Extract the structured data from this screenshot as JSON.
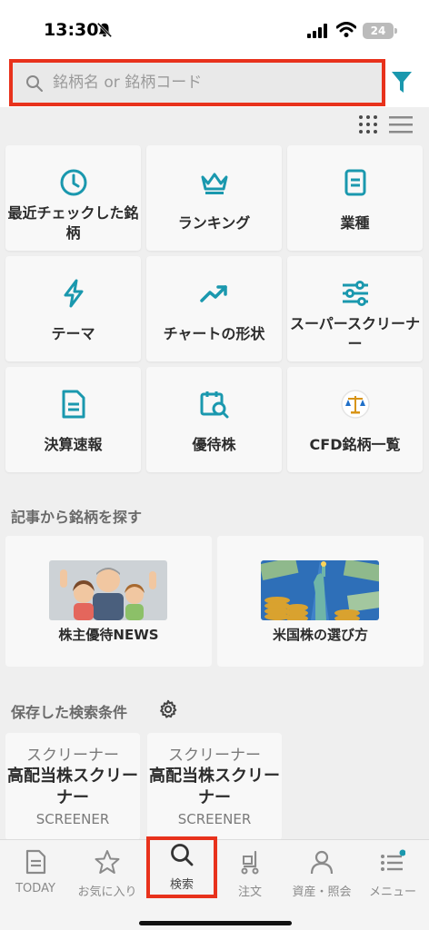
{
  "status_bar": {
    "time": "13:30",
    "battery": "24"
  },
  "search": {
    "placeholder": "銘柄名 or 銘柄コード"
  },
  "icons": {
    "search": "search-icon",
    "filter": "filter-icon",
    "grid": "grid-view-icon",
    "list": "list-view-icon",
    "gear": "gear-icon"
  },
  "accent_color": "#1a98ae",
  "highlight_color": "#e8321c",
  "tiles": [
    {
      "label": "最近チェックした銘柄",
      "icon": "clock-icon"
    },
    {
      "label": "ランキング",
      "icon": "crown-icon"
    },
    {
      "label": "業種",
      "icon": "document-icon"
    },
    {
      "label": "テーマ",
      "icon": "lightning-icon"
    },
    {
      "label": "チャートの形状",
      "icon": "trend-icon"
    },
    {
      "label": "スーパースクリーナー",
      "icon": "sliders-icon"
    },
    {
      "label": "決算速報",
      "icon": "report-icon"
    },
    {
      "label": "優待株",
      "icon": "calendar-search-icon"
    },
    {
      "label": "CFD銘柄一覧",
      "icon": "scale-icon"
    }
  ],
  "articles_section": {
    "title": "記事から銘柄を探す"
  },
  "articles": [
    {
      "label": "株主優待NEWS"
    },
    {
      "label": "米国株の選び方"
    }
  ],
  "saved_section": {
    "title": "保存した検索条件"
  },
  "saved_conditions": [
    {
      "kind": "スクリーナー",
      "name": "高配当株スクリーナー",
      "tag": "SCREENER"
    },
    {
      "kind": "スクリーナー",
      "name": "高配当株スクリーナー",
      "tag": "SCREENER"
    }
  ],
  "tabs": [
    {
      "label": "TODAY",
      "icon": "news-icon",
      "active": false
    },
    {
      "label": "お気に入り",
      "icon": "star-icon",
      "active": false
    },
    {
      "label": "検索",
      "icon": "search-icon",
      "active": true
    },
    {
      "label": "注文",
      "icon": "cart-icon",
      "active": false
    },
    {
      "label": "資産・照会",
      "icon": "person-icon",
      "active": false
    },
    {
      "label": "メニュー",
      "icon": "menu-icon",
      "active": false
    }
  ]
}
